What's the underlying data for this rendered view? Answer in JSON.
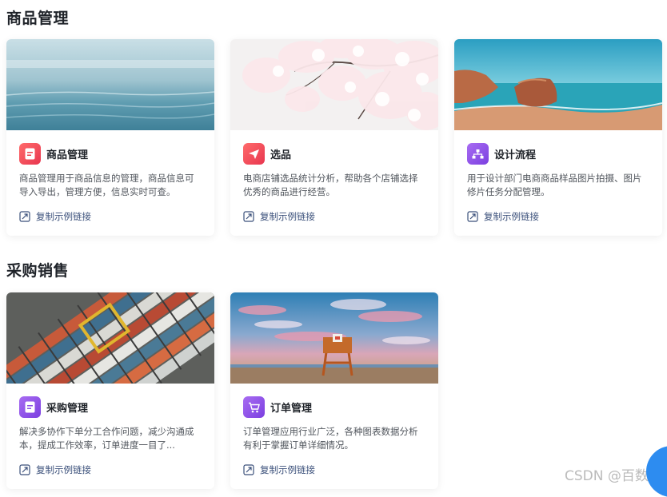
{
  "sections": [
    {
      "title": "商品管理",
      "cards": [
        {
          "name": "商品管理",
          "desc": "商品管理用于商品信息的管理，商品信息可导入导出，管理方便，信息实时可查。",
          "link": "复制示例链接",
          "icon": "document-icon",
          "icon_color": "#f0414f"
        },
        {
          "name": "选品",
          "desc": "电商店铺选品统计分析，帮助各个店铺选择优秀的商品进行经营。",
          "link": "复制示例链接",
          "icon": "send-icon",
          "icon_color": "#f0414f"
        },
        {
          "name": "设计流程",
          "desc": "用于设计部门电商商品样品图片拍摄、图片修片任务分配管理。",
          "link": "复制示例链接",
          "icon": "org-chart-icon",
          "icon_color": "#8b4fe6"
        }
      ]
    },
    {
      "title": "采购销售",
      "cards": [
        {
          "name": "采购管理",
          "desc": "解决多协作下单分工合作问题，减少沟通成本，提成工作效率，订单进度一目了...",
          "link": "复制示例链接",
          "icon": "document-icon",
          "icon_color": "#8b4fe6"
        },
        {
          "name": "订单管理",
          "desc": "订单管理应用行业广泛，各种图表数据分析有利于掌握订单详细情况。",
          "link": "复制示例链接",
          "icon": "cart-icon",
          "icon_color": "#8b4fe6"
        }
      ]
    }
  ],
  "watermark": "CSDN @百数"
}
